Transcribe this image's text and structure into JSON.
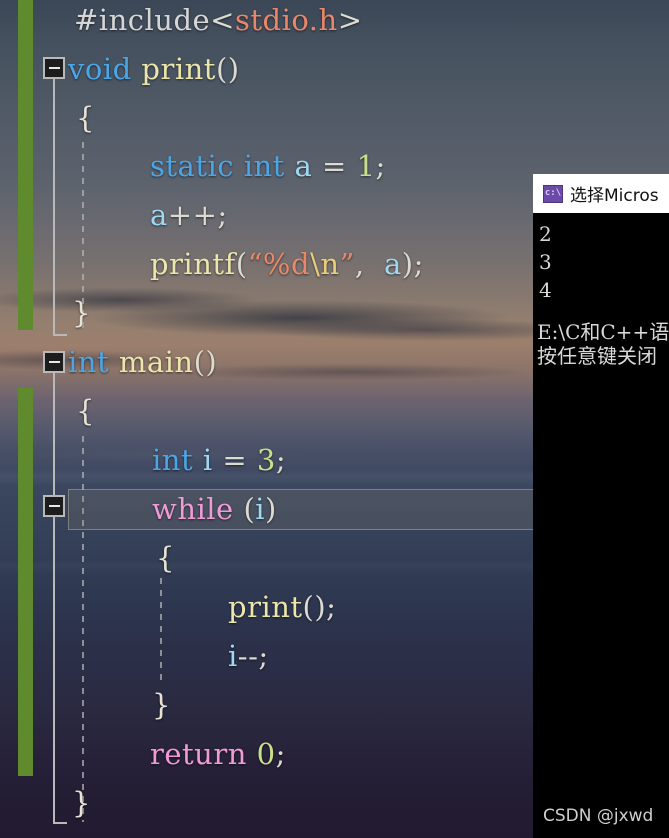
{
  "editor": {
    "language": "C",
    "code_lines": [
      {
        "id": "l1",
        "indent": 0,
        "text": "#include<stdio.h>"
      },
      {
        "id": "l2",
        "indent": 0,
        "text": "void print()"
      },
      {
        "id": "l3",
        "indent": 1,
        "text": "{"
      },
      {
        "id": "l4",
        "indent": 2,
        "text": "static int a = 1;"
      },
      {
        "id": "l5",
        "indent": 2,
        "text": "a++;"
      },
      {
        "id": "l6",
        "indent": 2,
        "text": "printf(\"%d\\n\", a);"
      },
      {
        "id": "l7",
        "indent": 1,
        "text": "}"
      },
      {
        "id": "l8",
        "indent": 0,
        "text": "int main()"
      },
      {
        "id": "l9",
        "indent": 1,
        "text": "{"
      },
      {
        "id": "l10",
        "indent": 2,
        "text": "int i = 3;"
      },
      {
        "id": "l11",
        "indent": 2,
        "text": "while (i)"
      },
      {
        "id": "l12",
        "indent": 2,
        "text": "{"
      },
      {
        "id": "l13",
        "indent": 3,
        "text": "print();"
      },
      {
        "id": "l14",
        "indent": 3,
        "text": "i--;"
      },
      {
        "id": "l15",
        "indent": 2,
        "text": "}"
      },
      {
        "id": "l16",
        "indent": 2,
        "text": "return 0;"
      },
      {
        "id": "l17",
        "indent": 1,
        "text": "}"
      }
    ],
    "highlighted_line": "while (i)",
    "fold_markers": [
      {
        "for_line": "void print()",
        "state": "expanded",
        "glyph": "minus"
      },
      {
        "for_line": "int main()",
        "state": "expanded",
        "glyph": "minus"
      },
      {
        "for_line": "while (i)",
        "state": "expanded",
        "glyph": "minus"
      }
    ],
    "colors": {
      "keyword": "#4ba6e8",
      "control_keyword": "#f09ad8",
      "function": "#ebe6ac",
      "identifier": "#9fd8f5",
      "number": "#c9e08a",
      "string": "#e8876a",
      "escape": "#e8cf7a",
      "punctuation": "#dcdbd2",
      "preprocessor": "#d6d6d6",
      "change_bar": "#5f8a2e"
    }
  },
  "console": {
    "title": "选择Micros",
    "icon_label": "c:\\",
    "output_lines": [
      "2",
      "3",
      "4"
    ],
    "path_line": "E:\\C和C++语",
    "prompt_line": "按任意键关闭",
    "background": "#000000",
    "titlebar_background": "#ffffff"
  },
  "watermark": {
    "text": "CSDN @jxwd"
  }
}
